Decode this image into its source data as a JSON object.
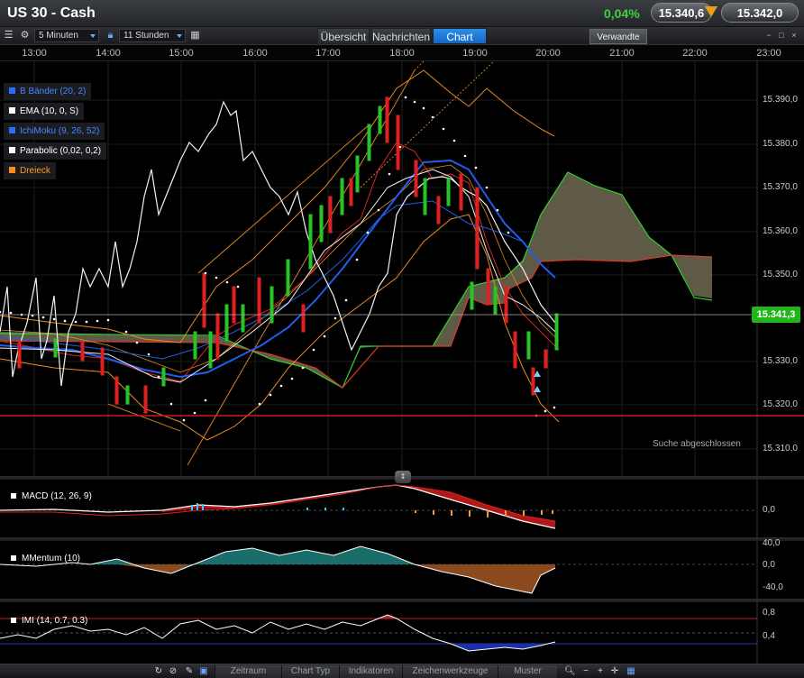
{
  "window": {
    "title": "US 30 - Cash",
    "change_pct": "0,04%",
    "sell_price": "15.340,6",
    "buy_price": "15.342,0"
  },
  "toolbar": {
    "interval": "5 Minuten",
    "range": "11 Stunden",
    "tabs": [
      "Übersicht",
      "Nachrichten",
      "Chart"
    ],
    "active_tab": "Chart",
    "related_button": "Verwandte"
  },
  "time_axis": [
    "13:00",
    "14:00",
    "15:00",
    "16:00",
    "17:00",
    "18:00",
    "19:00",
    "20:00",
    "21:00",
    "22:00",
    "23:00"
  ],
  "main_chart": {
    "legend": [
      {
        "label": "B Bänder (20, 2)",
        "color": "#2a6cff"
      },
      {
        "label": "EMA (10, 0, S)",
        "color": "#ffffff"
      },
      {
        "label": "IchiMoku (9, 26, 52)",
        "color": "#2a6cff"
      },
      {
        "label": "Parabolic (0,02, 0,2)",
        "color": "#ffffff"
      },
      {
        "label": "Dreieck",
        "color": "#ff8a1a"
      }
    ],
    "y_ticks": [
      "15.390,0",
      "15.380,0",
      "15.370,0",
      "15.360,0",
      "15.350,0",
      "15.330,0",
      "15.320,0",
      "15.310,0"
    ],
    "current_price": "15.341,3",
    "status": "Suche abgeschlossen"
  },
  "macd": {
    "label": "MACD (12, 26, 9)",
    "ticks": [
      "0,0"
    ]
  },
  "momentum": {
    "label": "MMentum (10)",
    "ticks": [
      "40,0",
      "0,0",
      "-40,0"
    ]
  },
  "imi": {
    "label": "IMI (14, 0.7, 0.3)",
    "ticks": [
      "0,8",
      "0,4"
    ]
  },
  "bottom_bar": {
    "tabs": [
      "Zeitraum",
      "Chart Typ",
      "Indikatoren",
      "Zeichenwerkzeuge",
      "Muster"
    ]
  }
}
